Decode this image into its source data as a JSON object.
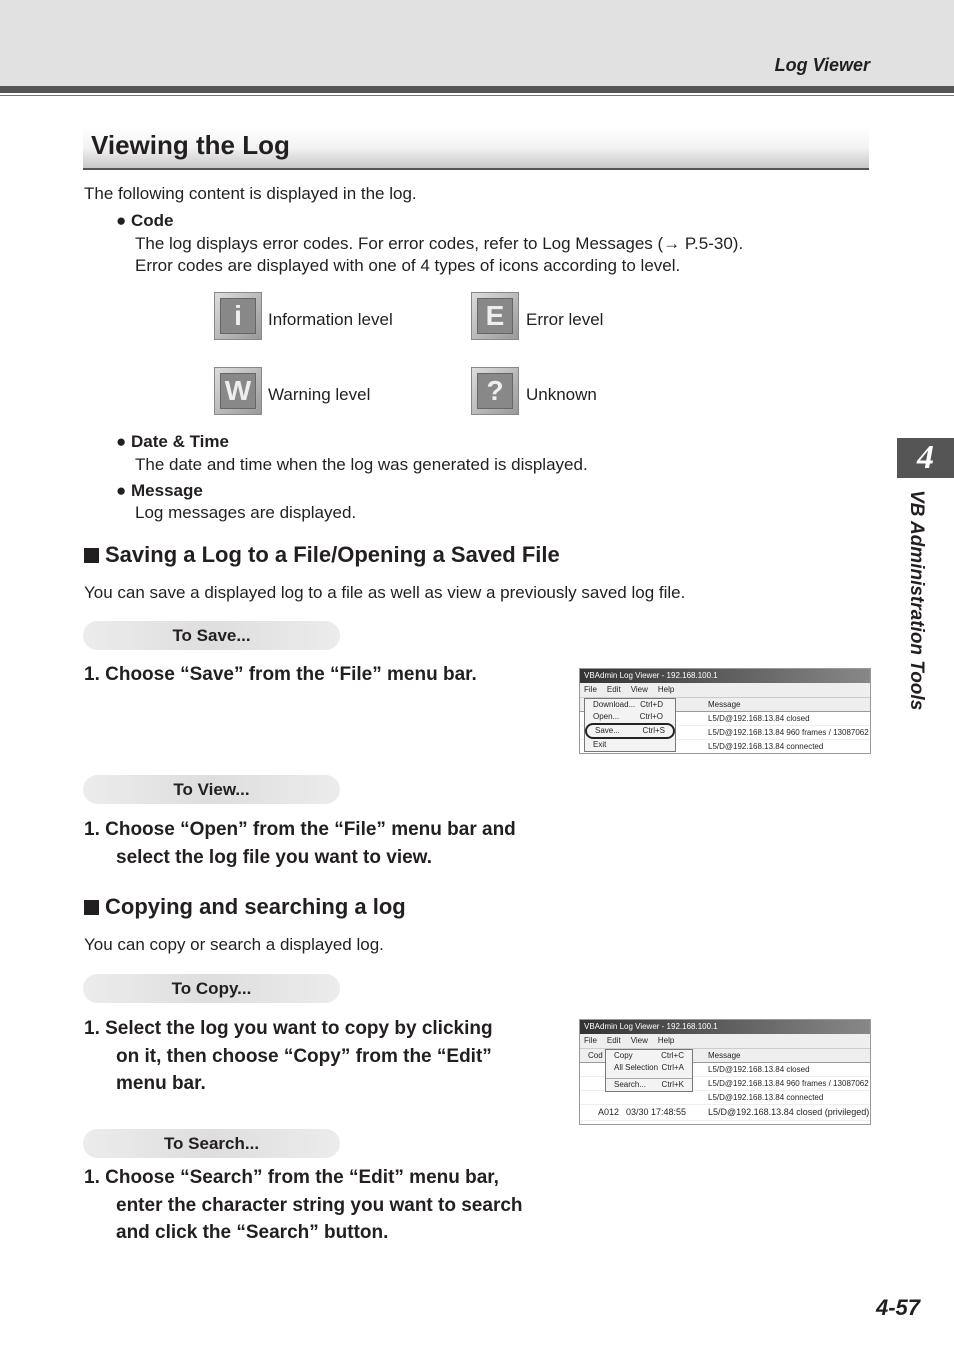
{
  "header": {
    "running_head": "Log Viewer"
  },
  "title": "Viewing the Log",
  "intro": "The following content is displayed in the log.",
  "code": {
    "heading": "Code",
    "line1": "The log displays error codes. For error codes, refer to Log Messages (→ P.5-30).",
    "line2": "Error codes are displayed with one of 4 types of icons according to level.",
    "levels": [
      {
        "icon": "information-icon",
        "glyph": "i",
        "label": "Information level"
      },
      {
        "icon": "error-icon",
        "glyph": "E",
        "label": "Error level"
      },
      {
        "icon": "warning-icon",
        "glyph": "W",
        "label": "Warning level"
      },
      {
        "icon": "unknown-icon",
        "glyph": "?",
        "label": "Unknown"
      }
    ]
  },
  "datetime": {
    "heading": "Date & Time",
    "text": "The date and time when the log was generated is displayed."
  },
  "message": {
    "heading": "Message",
    "text": "Log messages are displayed."
  },
  "save_section": {
    "heading": "Saving a Log to a File/Opening a Saved File",
    "text": "You can save a displayed log to a file as well as view a previously saved log file.",
    "to_save": "To Save...",
    "save_step": "1.  Choose “Save” from the “File” menu bar.",
    "to_view": "To View...",
    "view_step1": "1.  Choose “Open” from the “File” menu bar and",
    "view_step2": "select the log file you want to view."
  },
  "copy_section": {
    "heading": "Copying and searching a log",
    "text": "You can copy or search a displayed log.",
    "to_copy": "To Copy...",
    "copy_step1": "1.  Select the log you want to copy by clicking",
    "copy_step2": "on it, then choose “Copy” from the “Edit”",
    "copy_step3": "menu bar.",
    "to_search": "To Search...",
    "search_step1": "1.  Choose “Search” from the “Edit” menu bar,",
    "search_step2": "enter the character string you want to search",
    "search_step3": "and click the “Search” button."
  },
  "screenshot": {
    "window_title": "VBAdmin Log Viewer - 192.168.100.1",
    "menus": [
      "File",
      "Edit",
      "View",
      "Help"
    ],
    "col_code": "Cod",
    "col_message": "Message",
    "rows": [
      "L5/D@192.168.13.84 closed",
      "L5/D@192.168.13.84 960 frames / 13087062",
      "L5/D@192.168.13.84 connected",
      "L5/D@192.168.13.84 closed (privileged)"
    ],
    "row_code": "A012",
    "row_time": "03/30 17:48:55",
    "file_menu": [
      [
        "Download...",
        "Ctrl+D"
      ],
      [
        "Open...",
        "Ctrl+O"
      ],
      [
        "Save...",
        "Ctrl+S"
      ],
      [
        "Exit",
        ""
      ]
    ],
    "edit_menu": [
      [
        "Copy",
        "Ctrl+C"
      ],
      [
        "All Selection",
        "Ctrl+A"
      ],
      [
        "Search...",
        "Ctrl+K"
      ]
    ]
  },
  "side_tab": {
    "chapter": "4",
    "label": "VB Administration Tools"
  },
  "page_number": "4-57"
}
